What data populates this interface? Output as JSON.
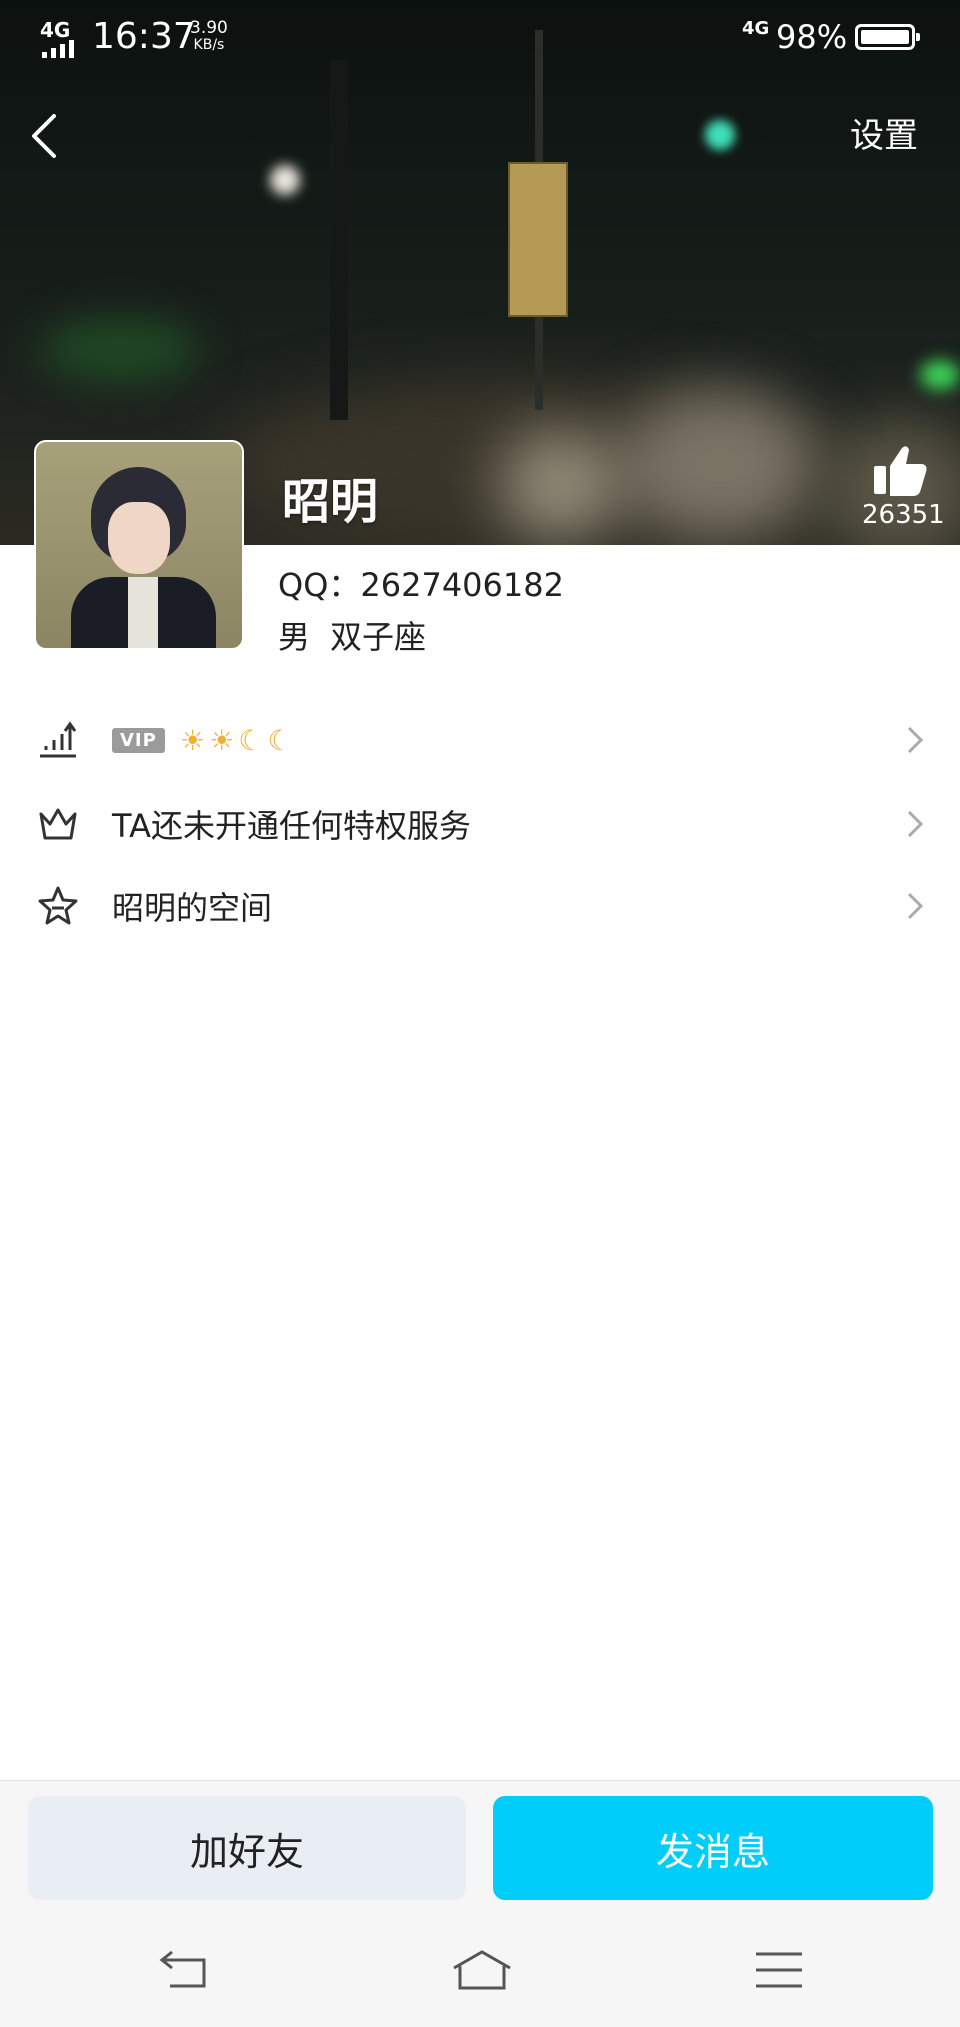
{
  "status_bar": {
    "network_left": "4G",
    "time": "16:37",
    "speed_value": "3.90",
    "speed_unit": "KB/s",
    "network_right": "4G",
    "battery": "98%"
  },
  "header": {
    "settings_label": "设置",
    "name": "昭明",
    "likes": "26351"
  },
  "profile": {
    "qq": "QQ：2627406182",
    "gender": "男",
    "zodiac": "双子座"
  },
  "rows": {
    "vip_badge": "VIP",
    "level_icons": [
      "sun-icon",
      "sun-icon",
      "moon-icon",
      "moon-icon"
    ],
    "privilege": "TA还未开通任何特权服务",
    "space": "昭明的空间"
  },
  "actions": {
    "add_friend": "加好友",
    "send_message": "发消息"
  },
  "colors": {
    "primary": "#00cdf9",
    "secondary_button": "#e9eef5"
  }
}
